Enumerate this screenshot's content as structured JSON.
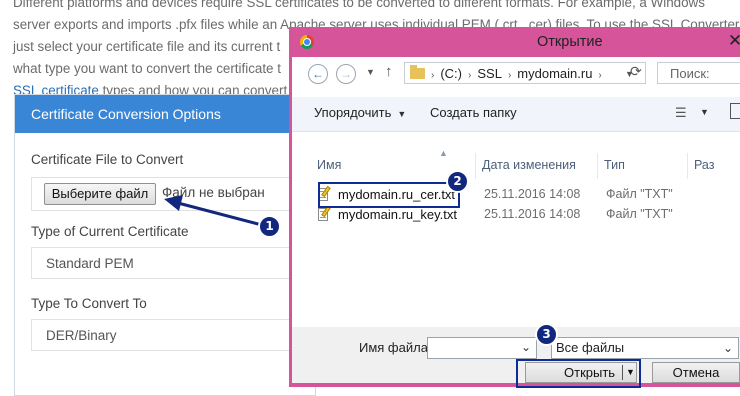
{
  "page": {
    "intro_lines": [
      "Different platforms and devices require SSL certificates to be converted to different formats. For example, a Windows",
      "server exports and imports .pfx files while an Apache server uses individual PEM (.crt, .cer) files. To use the SSL Converter,",
      "just select your certificate file and its current t",
      "what type you want to convert the certificate t"
    ],
    "last_line_link": "SSL certificate",
    "last_line_rest": " types and how you can convert"
  },
  "panel": {
    "title": "Certificate Conversion Options",
    "file_label": "Certificate File to Convert",
    "choose_file_button": "Выберите файл",
    "no_file_text": "Файл не выбран",
    "current_type_label": "Type of Current Certificate",
    "current_type_value": "Standard PEM",
    "convert_to_label": "Type To Convert To",
    "convert_to_value": "DER/Binary"
  },
  "dialog": {
    "title": "Открытие",
    "close_glyph": "✕",
    "breadcrumb": [
      "(C:)",
      "SSL",
      "mydomain.ru"
    ],
    "search_placeholder": "Поиск:",
    "toolbar": {
      "organize": "Упорядочить",
      "new_folder": "Создать папку"
    },
    "columns": {
      "name": "Имя",
      "date": "Дата изменения",
      "type": "Тип",
      "size": "Раз"
    },
    "files": [
      {
        "name": "mydomain.ru_cer.txt",
        "date": "25.11.2016 14:08",
        "type": "Файл \"TXT\""
      },
      {
        "name": "mydomain.ru_key.txt",
        "date": "25.11.2016 14:08",
        "type": "Файл \"TXT\""
      }
    ],
    "filename_label": "Имя файла:",
    "filename_value": "",
    "filter_value": "Все файлы",
    "open_button": "Открыть",
    "cancel_button": "Отмена"
  },
  "annotations": {
    "step1": "1",
    "step2": "2",
    "step3": "3",
    "color": "#12287e"
  },
  "icons": [
    "chrome-icon",
    "back-icon",
    "forward-icon",
    "up-icon",
    "folder-icon",
    "refresh-icon",
    "view-icon",
    "preview-pane-icon",
    "text-file-icon",
    "close-icon"
  ]
}
